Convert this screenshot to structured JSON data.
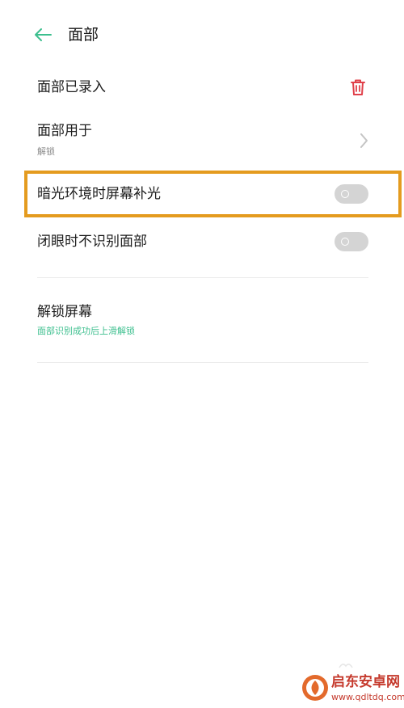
{
  "header": {
    "title": "面部",
    "back_icon": "arrow-left-icon"
  },
  "colors": {
    "accent": "#3cbf8e",
    "delete": "#e0404a",
    "highlight": "#e49b1f",
    "toggle_off": "#d4d4d4"
  },
  "settings": {
    "face_enrolled": {
      "label": "面部已录入",
      "action_icon": "trash-icon"
    },
    "face_used_for": {
      "label": "面部用于",
      "value": "解锁",
      "action_icon": "chevron-right-icon"
    },
    "dark_fill_light": {
      "label": "暗光环境时屏幕补光",
      "enabled": false
    },
    "eyes_closed": {
      "label": "闭眼时不识别面部",
      "enabled": false
    },
    "unlock_screen": {
      "label": "解锁屏幕",
      "value": "面部识别成功后上滑解锁"
    }
  },
  "watermark": {
    "title": "启东安卓网",
    "url": "www.qdltdq.com"
  }
}
